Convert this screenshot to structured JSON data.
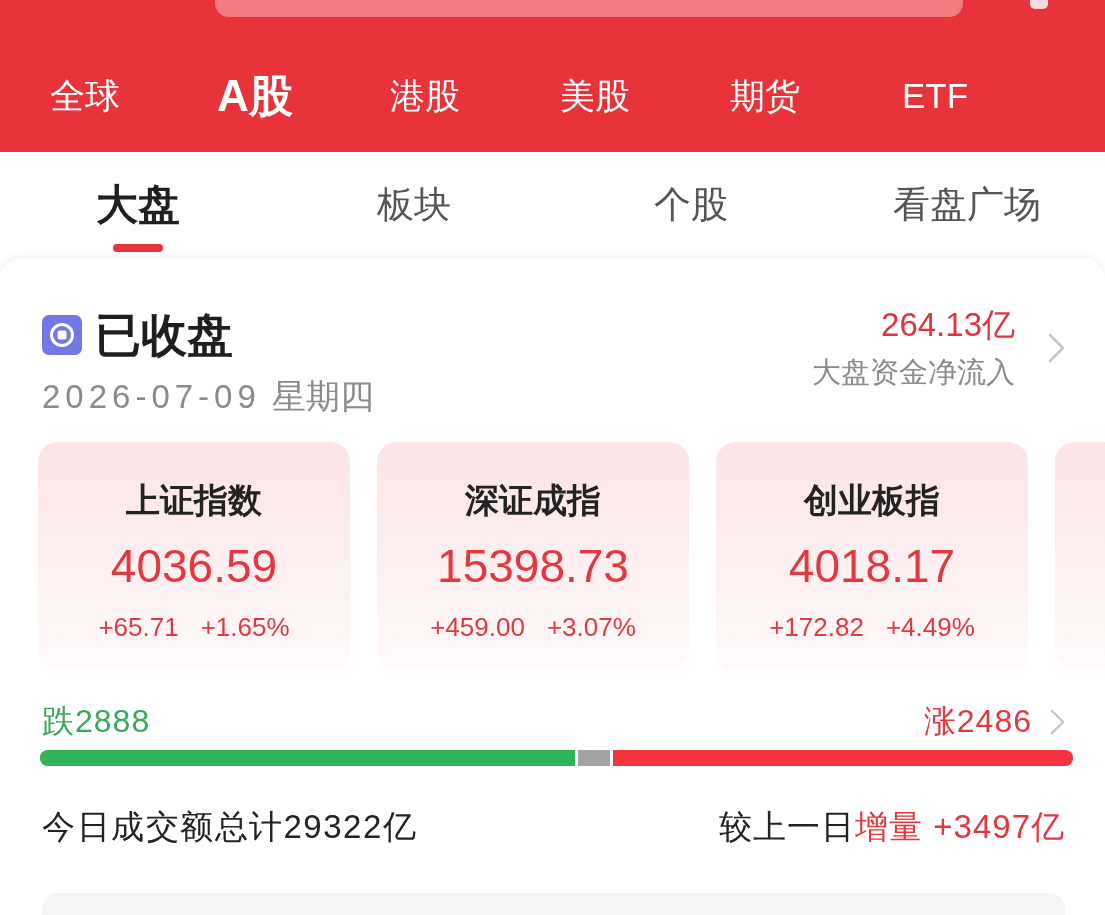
{
  "market_tabs": [
    {
      "label": "全球",
      "selected": false
    },
    {
      "label": "A股",
      "selected": true
    },
    {
      "label": "港股",
      "selected": false
    },
    {
      "label": "美股",
      "selected": false
    },
    {
      "label": "期货",
      "selected": false
    },
    {
      "label": "ETF",
      "selected": false
    }
  ],
  "view_tabs": [
    {
      "label": "大盘",
      "selected": true
    },
    {
      "label": "板块",
      "selected": false
    },
    {
      "label": "个股",
      "selected": false
    },
    {
      "label": "看盘广场",
      "selected": false
    }
  ],
  "market_status": {
    "title": "已收盘",
    "date": "2026-07-09",
    "weekday": "星期四",
    "net_inflow": "264.13亿",
    "net_inflow_label": "大盘资金净流入"
  },
  "index_cards": [
    {
      "name": "上证指数",
      "value": "4036.59",
      "change": "+65.71",
      "change_percent": "+1.65%"
    },
    {
      "name": "深证成指",
      "value": "15398.73",
      "change": "+459.00",
      "change_percent": "+3.07%"
    },
    {
      "name": "创业板指",
      "value": "4018.17",
      "change": "+172.82",
      "change_percent": "+4.49%"
    }
  ],
  "breadth": {
    "fall": "跌2888",
    "rise": "涨2486",
    "fall_bar": {
      "level": 0.521
    },
    "rise_bar": {
      "level": 0.448
    }
  },
  "turnover": {
    "total": "今日成交额总计29322亿",
    "compare_label": "较上一日",
    "compare_change": "增量 +3497亿"
  }
}
